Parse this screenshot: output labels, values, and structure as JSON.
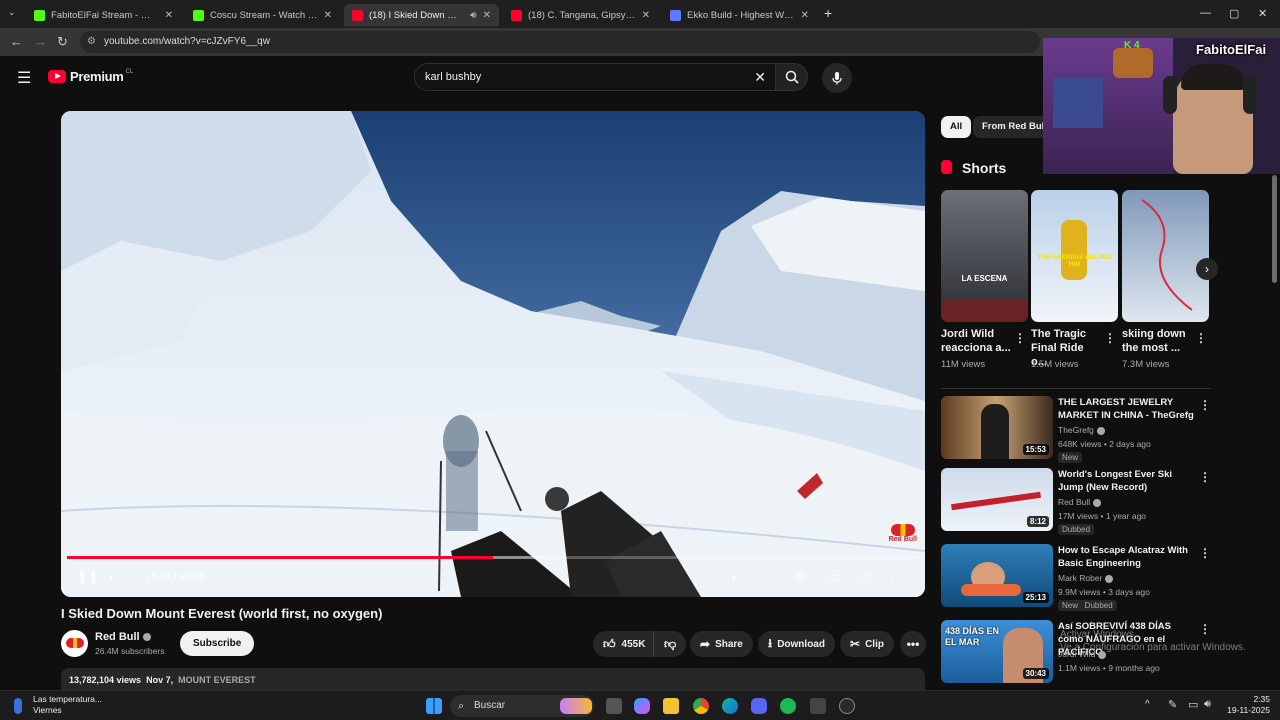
{
  "browser": {
    "tabs": [
      {
        "title": "FabitoElFai Stream - Watch Live",
        "icon": "kick-icon",
        "color": "#53fc18",
        "active": false
      },
      {
        "title": "Coscu Stream - Watch Live on",
        "icon": "kick-icon",
        "color": "#53fc18",
        "active": false
      },
      {
        "title": "(18) I Skied Down Mount E",
        "icon": "youtube-icon",
        "color": "#ff0033",
        "active": true
      },
      {
        "title": "(18) C. Tangana, Gipsy Kings, N",
        "icon": "youtube-icon",
        "color": "#ff0033",
        "active": false
      },
      {
        "title": "Ekko Build - Highest Win Rate",
        "icon": "site-icon",
        "color": "#5b7cff",
        "active": false
      }
    ],
    "new_tab": "+",
    "url": "youtube.com/watch?v=cJZvFY6__qw"
  },
  "youtube": {
    "logo_text": "Premium",
    "region": "CL",
    "search_query": "karl bushby"
  },
  "player": {
    "time": "15:37 / 31:15",
    "progress": 0.5,
    "watermark": "Red Bull"
  },
  "video": {
    "title": "I Skied Down Mount Everest (world first, no oxygen)",
    "channel": "Red Bull",
    "subscribers": "26.4M subscribers",
    "subscribe_label": "Subscribe",
    "likes": "455K",
    "share_label": "Share",
    "download_label": "Download",
    "clip_label": "Clip",
    "views": "13,782,104 views",
    "date": "Nov 7,",
    "tag": "MOUNT EVEREST"
  },
  "sidebar": {
    "chips": [
      "All",
      "From Red Bull"
    ],
    "shorts_title": "Shorts",
    "shorts": [
      {
        "title": "Jordi Wild reacciona a...",
        "views": "11M views",
        "overlay": "LA ESCENA"
      },
      {
        "title": "The Tragic Final Ride o...",
        "views": "1.5M views",
        "overlay": "THE SHERPAS HELPED HIM"
      },
      {
        "title": "skiing down the most ...",
        "views": "7.3M views",
        "overlay": ""
      }
    ],
    "recommended": [
      {
        "title": "THE LARGEST JEWELRY MARKET IN CHINA - TheGrefg",
        "channel": "TheGrefg",
        "stats": "648K views • 2 days ago",
        "badge": "New",
        "duration": "15:53"
      },
      {
        "title": "World's Longest Ever Ski Jump (New Record)",
        "channel": "Red Bull",
        "stats": "17M views • 1 year ago",
        "badge": "Dubbed",
        "duration": "8:12"
      },
      {
        "title": "How to Escape Alcatraz With Basic Engineering",
        "channel": "Mark Rober",
        "stats": "9.9M views • 3 days ago",
        "badge": "New   Dubbed",
        "duration": "25:13"
      },
      {
        "title": "Así SOBREVIVÍ 438 DÍAS como NÁUFRAGO en el PACÍFICO",
        "channel": "Jordi Wild",
        "stats": "1.1M views • 9 months ago",
        "badge": "",
        "duration": "30:43",
        "thumb_text": "438 DÍAS EN EL MAR"
      }
    ]
  },
  "overlay": {
    "streamer": "FabitoElFai",
    "kick_badge": "K 4",
    "activate_line1": "Activar Windows",
    "activate_line2": "Ve a Configuración para activar Windows."
  },
  "taskbar": {
    "weather_line1": "Las temperatura...",
    "weather_line2": "Viernes",
    "search_placeholder": "Buscar",
    "time": "2:35",
    "date": "19-11-2025"
  }
}
